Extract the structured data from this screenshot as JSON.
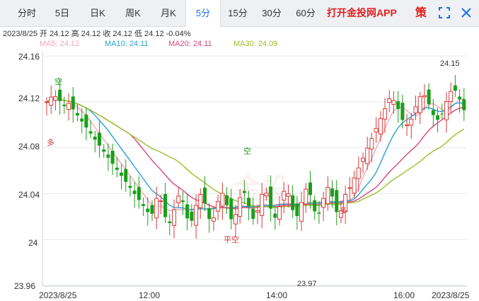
{
  "toolbar": {
    "tabs": [
      {
        "label": "分时"
      },
      {
        "label": "5日"
      },
      {
        "label": "日K"
      },
      {
        "label": "周K"
      },
      {
        "label": "月K"
      },
      {
        "label": "5分",
        "active": true
      },
      {
        "label": "15分"
      },
      {
        "label": "30分"
      },
      {
        "label": "60分"
      }
    ],
    "promo": "打开金投网APP",
    "strategy": "策",
    "fullscreen_icon": "fullscreen-icon",
    "close_icon": "close-icon"
  },
  "quote": {
    "date": "2023/8/25",
    "open_label": "开",
    "open": "24.12",
    "high_label": "高",
    "high": "24.12",
    "close_label": "收",
    "close": "24.12",
    "low_label": "低",
    "low": "24.12",
    "change": "-0.04%"
  },
  "ma": [
    {
      "label": "MA5: 24.12",
      "color": "#f4a6b8"
    },
    {
      "label": "MA10: 24.11",
      "color": "#29a3d4"
    },
    {
      "label": "MA20: 24.11",
      "color": "#d9477e"
    },
    {
      "label": "MA30: 24.09",
      "color": "#9bbf2a"
    }
  ],
  "chart_data": {
    "type": "candlestick",
    "y_ticks": [
      "24.16",
      "24.12",
      "24.08",
      "24.04",
      "24",
      "23.96"
    ],
    "ylim": [
      23.96,
      24.16
    ],
    "x_labels": [
      "2023/8/25",
      "12:00",
      "14:00",
      "16:00",
      "2023/8/25"
    ],
    "annotations": {
      "max": "24.15",
      "min": "23.97",
      "markers": [
        "空",
        "多",
        "空",
        "平空",
        "多"
      ]
    },
    "colors": {
      "up": "#d93a3a",
      "down": "#1a9e1a"
    }
  }
}
